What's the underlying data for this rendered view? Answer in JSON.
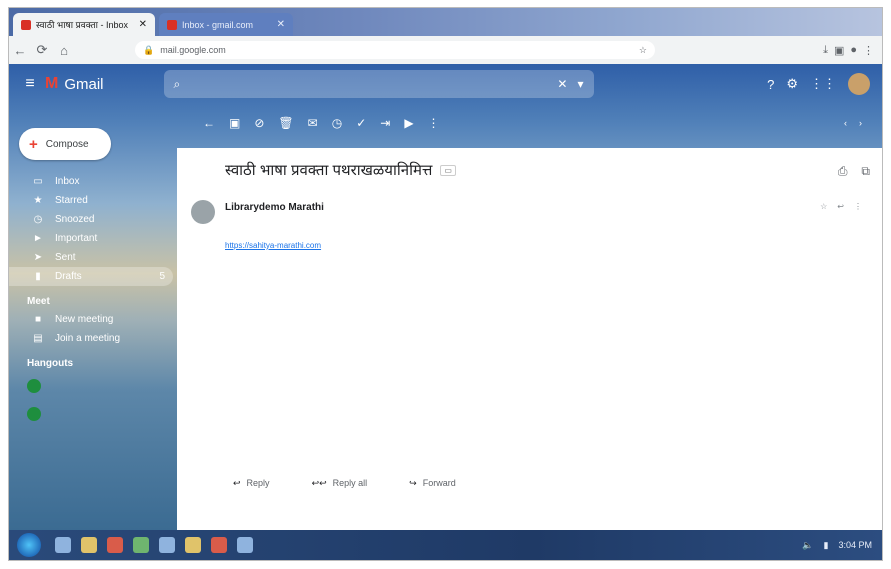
{
  "browser": {
    "tabs": [
      {
        "title": "स्वाठी भाषा प्रवक्ता - Inbox"
      },
      {
        "title": "Inbox - gmail.com"
      }
    ],
    "url": "mail.google.com"
  },
  "gmail": {
    "logo": "Gmail",
    "compose": "Compose",
    "nav": [
      {
        "label": "Inbox",
        "icon": "inbox-icon"
      },
      {
        "label": "Starred",
        "icon": "star-icon"
      },
      {
        "label": "Snoozed",
        "icon": "clock-icon"
      },
      {
        "label": "Important",
        "icon": "label-icon"
      },
      {
        "label": "Sent",
        "icon": "send-icon"
      },
      {
        "label": "Drafts",
        "icon": "file-icon",
        "count": "5"
      }
    ],
    "meet_heading": "Meet",
    "meet_items": [
      "New meeting",
      "Join a meeting"
    ],
    "hangouts_heading": "Hangouts"
  },
  "email": {
    "subject": "स्वाठी भाषा प्रवक्ता पथराखळयानिमित्त",
    "sender_name": "Librarydemo Marathi",
    "body_link": "https://sahitya-marathi.com"
  },
  "actions": [
    "Reply",
    "Reply all",
    "Forward"
  ],
  "taskbar": {
    "clock": "3:04 PM"
  },
  "colors": {
    "accent": "#1a73e8",
    "compose_plus": "#ea4335"
  }
}
